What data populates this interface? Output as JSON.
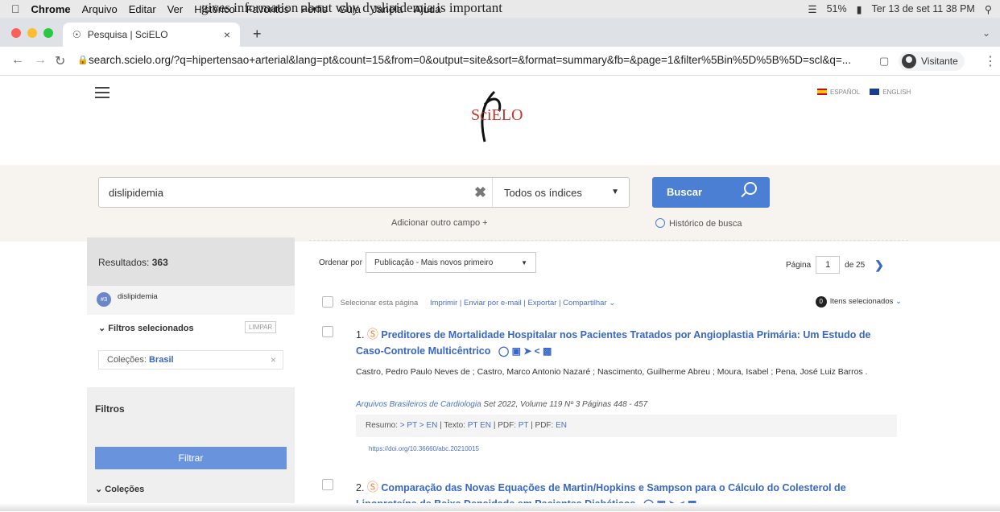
{
  "menubar": {
    "app": "Chrome",
    "items": [
      "Arquivo",
      "Editar",
      "Ver",
      "Histórico",
      "Favoritos",
      "Perfis",
      "Guia",
      "Janela",
      "Ajuda"
    ],
    "battery": "51%",
    "clock": "Ter 13 de set 11 38 PM"
  },
  "caption": "gives information about why dyslipidemia is important",
  "tab": {
    "title": "Pesquisa | SciELO"
  },
  "address": {
    "url": "search.scielo.org/?q=hipertensao+arterial&lang=pt&count=15&from=0&output=site&sort=&format=summary&fb=&page=1&filter%5Bin%5D%5B%5D=scl&q=...",
    "profile": "Visitante"
  },
  "header": {
    "lang_es": "ESPAÑOL",
    "lang_en": "ENGLISH",
    "logo": "SciELO"
  },
  "search": {
    "value": "dislipidemia",
    "index": "Todos os índices",
    "button": "Buscar",
    "add_field": "Adicionar outro campo +",
    "history": "Histórico de busca"
  },
  "sidebar": {
    "results_label": "Resultados:",
    "results_count": "363",
    "query_badge": "#3",
    "query": "dislipidemia",
    "selected_filters": "Filtros selecionados",
    "clear": "LIMPAR",
    "chip_label": "Coleções:",
    "chip_value": "Brasil",
    "filters_title": "Filtros",
    "filter_button": "Filtrar",
    "collections": "Coleções"
  },
  "results_bar": {
    "sort_label": "Ordenar por",
    "sort_value": "Publicação - Mais novos primeiro",
    "page_label": "Página",
    "page": "1",
    "of": "de 25"
  },
  "selection": {
    "select_page": "Selecionar esta página",
    "actions": "Imprimir | Enviar por e-mail | Exportar | Compartilhar",
    "count": "0",
    "selected": "Itens selecionados"
  },
  "results": [
    {
      "num": "1.",
      "title": "Preditores de Mortalidade Hospitalar nos Pacientes Tratados por Angioplastia Primária: Um Estudo de Caso-Controle Multicêntrico",
      "authors": "Castro, Pedro Paulo Neves de ; Castro, Marco Antonio Nazaré ; Nascimento, Guilherme Abreu ; Moura, Isabel ; Pena, José Luiz Barros .",
      "journal": "Arquivos Brasileiros de Cardiologia",
      "journal_rest": "Set 2022, Volume 119   Nº 3   Páginas 448 - 457",
      "resumo": "Resumo:",
      "resumo_links": "> PT  > EN",
      "texto": "Texto:",
      "texto_links": "PT  EN",
      "pdf1": "PDF:",
      "pdf1_link": "PT",
      "pdf2": "PDF:",
      "pdf2_link": "EN",
      "doi": "https://doi.org/10.36660/abc.20210015"
    },
    {
      "num": "2.",
      "title": "Comparação das Novas Equações de Martin/Hopkins e Sampson para o Cálculo do Colesterol de Lipoproteína de Baixa Densidade em Pacientes Diabéticos"
    }
  ]
}
